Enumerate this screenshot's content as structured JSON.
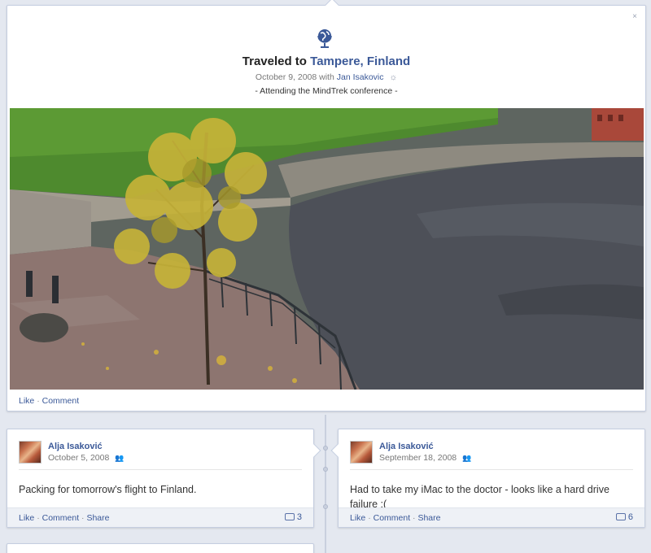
{
  "feature": {
    "title_prefix": "Traveled to",
    "place": "Tampere, Finland",
    "date": "October 9, 2008 with",
    "with_person": "Jan Isakovic",
    "caption": "- Attending the MindTrek conference -",
    "close_label": "×",
    "actions": {
      "like": "Like",
      "comment": "Comment"
    }
  },
  "posts": [
    {
      "author": "Alja Isaković",
      "date": "October 5, 2008",
      "text": "Packing for tomorrow's flight to Finland.",
      "actions": {
        "like": "Like",
        "comment": "Comment",
        "share": "Share"
      },
      "comment_count": "3"
    },
    {
      "author": "Alja Isaković",
      "date": "September 18, 2008",
      "text": "Had to take my iMac to the doctor - looks like a hard drive failure :(",
      "actions": {
        "like": "Like",
        "comment": "Comment",
        "share": "Share"
      },
      "comment_count": "6"
    }
  ],
  "icons": {
    "globe": "globe-icon",
    "gear": "gear-icon",
    "friends": "friends-icon",
    "comment": "comment-bubble-icon"
  },
  "colors": {
    "link": "#3b5998",
    "background": "#e4e8f0"
  }
}
